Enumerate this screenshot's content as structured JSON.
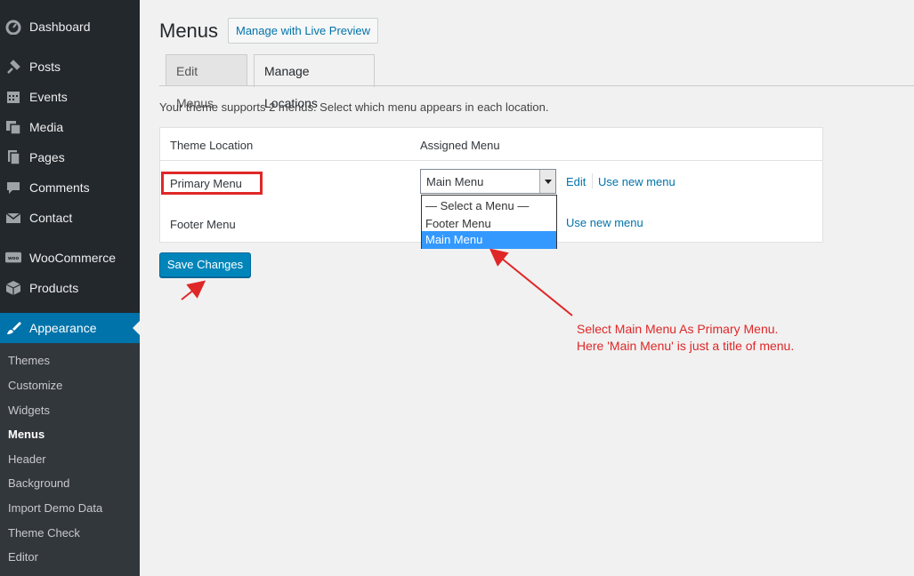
{
  "sidebar": {
    "items": [
      {
        "label": "Dashboard",
        "icon": "dashboard-icon"
      },
      {
        "label": "Posts",
        "icon": "pin-icon"
      },
      {
        "label": "Events",
        "icon": "calendar-icon"
      },
      {
        "label": "Media",
        "icon": "media-icon"
      },
      {
        "label": "Pages",
        "icon": "pages-icon"
      },
      {
        "label": "Comments",
        "icon": "comment-icon"
      },
      {
        "label": "Contact",
        "icon": "mail-icon"
      },
      {
        "label": "WooCommerce",
        "icon": "woo-icon"
      },
      {
        "label": "Products",
        "icon": "box-icon"
      },
      {
        "label": "Appearance",
        "icon": "brush-icon"
      }
    ],
    "submenu": [
      "Themes",
      "Customize",
      "Widgets",
      "Menus",
      "Header",
      "Background",
      "Import Demo Data",
      "Theme Check",
      "Editor"
    ],
    "current_sub": "Menus"
  },
  "header": {
    "title": "Menus",
    "live_preview_label": "Manage with Live Preview"
  },
  "tabs": [
    {
      "label": "Edit Menus"
    },
    {
      "label": "Manage Locations"
    }
  ],
  "intro_text": "Your theme supports 2 menus. Select which menu appears in each location.",
  "table": {
    "col_location": "Theme Location",
    "col_assigned": "Assigned Menu",
    "rows": [
      {
        "location": "Primary Menu",
        "selected": "Main Menu",
        "edit_label": "Edit",
        "new_label": "Use new menu"
      },
      {
        "location": "Footer Menu",
        "new_label": "Use new menu"
      }
    ]
  },
  "dropdown": {
    "options": [
      "— Select a Menu —",
      "Footer Menu",
      "Main Menu"
    ],
    "selected": "Main Menu"
  },
  "save_label": "Save Changes",
  "annotation": {
    "line1": "Select Main Menu As Primary Menu.",
    "line2": "Here 'Main Menu' is just a title of menu.",
    "color": "#e02727"
  },
  "colors": {
    "sidebar_bg": "#23282d",
    "active_bg": "#0073aa",
    "link": "#0073aa",
    "button": "#0085ba"
  }
}
